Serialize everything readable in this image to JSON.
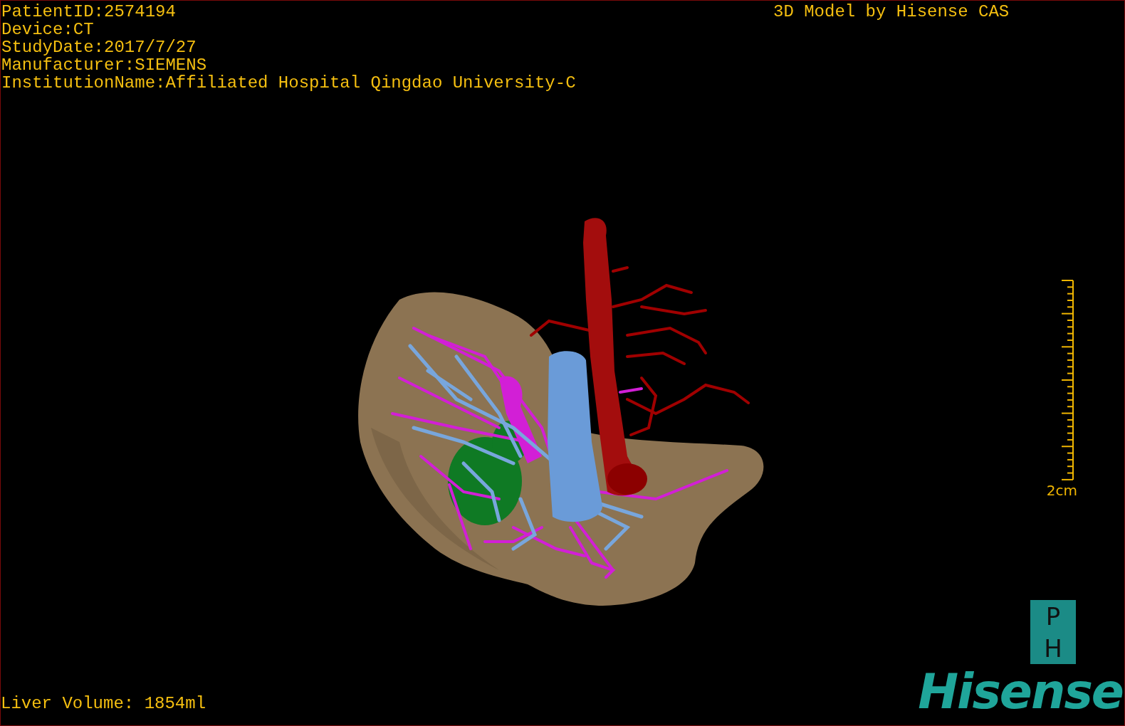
{
  "patient_info": [
    "PatientID:2574194",
    "Device:CT",
    "StudyDate:2017/7/27",
    "Manufacturer:SIEMENS",
    "InstitutionName:Affiliated Hospital Qingdao University-C"
  ],
  "model_caption": "3D Model by Hisense CAS",
  "scale_bar": {
    "label": "2cm"
  },
  "logo": {
    "badge_top": "P",
    "badge_bottom": "H",
    "wordmark": "Hisense"
  },
  "liver_volume": "Liver Volume: 1854ml"
}
